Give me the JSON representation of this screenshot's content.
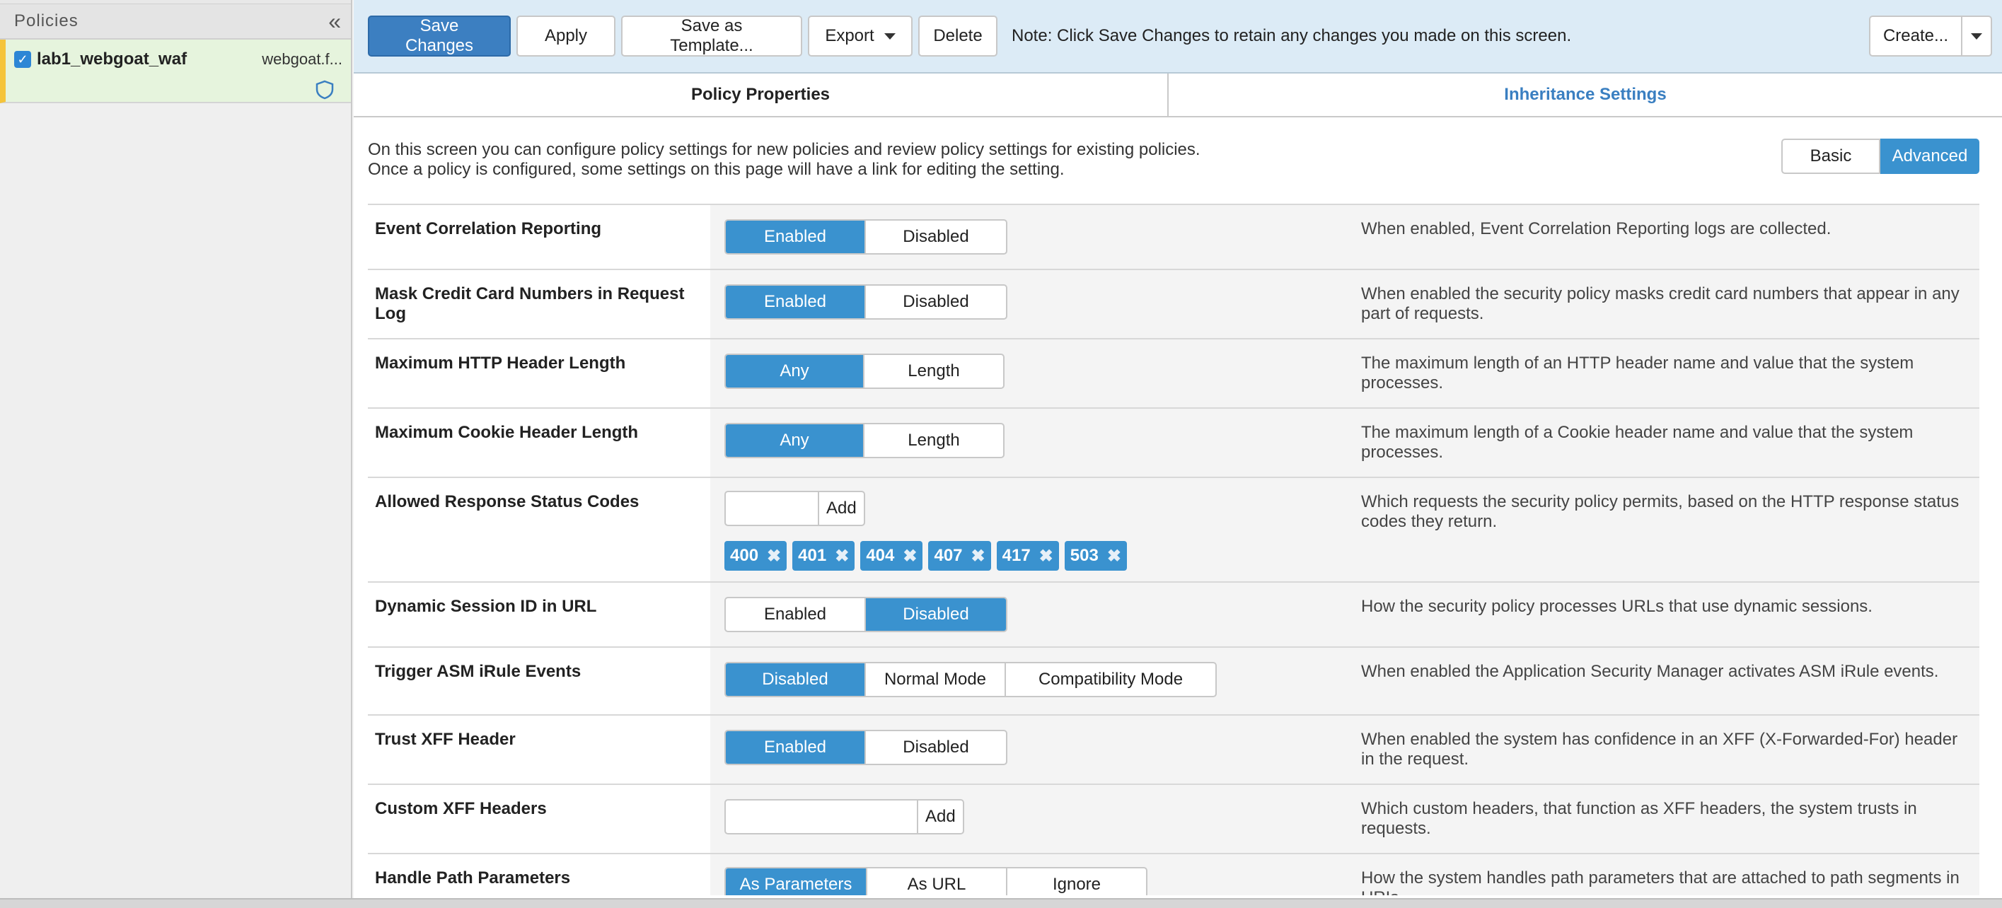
{
  "sidebar": {
    "title": "Policies",
    "collapse_icon": "«",
    "policy": {
      "name": "lab1_webgoat_waf",
      "host": "webgoat.f...",
      "checked": true
    }
  },
  "toolbar": {
    "save_label": "Save Changes",
    "apply_label": "Apply",
    "save_template_label": "Save as Template...",
    "export_label": "Export",
    "delete_label": "Delete",
    "note": "Note: Click Save Changes to retain any changes you made on this screen.",
    "create_label": "Create..."
  },
  "tabs": {
    "active": "Policy Properties",
    "inactive": "Inheritance Settings"
  },
  "intro": {
    "line1": "On this screen you can configure policy settings for new policies and review policy settings for existing policies.",
    "line2": "Once a policy is configured, some settings on this page will have a link for editing the setting.",
    "basic_label": "Basic",
    "advanced_label": "Advanced"
  },
  "settings": [
    {
      "label": "Event Correlation Reporting",
      "options": [
        "Enabled",
        "Disabled"
      ],
      "selected": "Enabled",
      "description": "When enabled, Event Correlation Reporting logs are collected."
    },
    {
      "label": "Mask Credit Card Numbers in Request Log",
      "options": [
        "Enabled",
        "Disabled"
      ],
      "selected": "Enabled",
      "description": "When enabled the security policy masks credit card numbers that appear in any part of requests."
    },
    {
      "label": "Maximum HTTP Header Length",
      "options": [
        "Any",
        "Length"
      ],
      "selected": "Any",
      "description": "The maximum length of an HTTP header name and value that the system processes."
    },
    {
      "label": "Maximum Cookie Header Length",
      "options": [
        "Any",
        "Length"
      ],
      "selected": "Any",
      "description": "The maximum length of a Cookie header name and value that the system processes."
    },
    {
      "label": "Allowed Response Status Codes",
      "add_label": "Add",
      "codes": [
        "400",
        "401",
        "404",
        "407",
        "417",
        "503"
      ],
      "description": "Which requests the security policy permits, based on the HTTP response status codes they return."
    },
    {
      "label": "Dynamic Session ID in URL",
      "options": [
        "Enabled",
        "Disabled"
      ],
      "selected": "Disabled",
      "description": "How the security policy processes URLs that use dynamic sessions."
    },
    {
      "label": "Trigger ASM iRule Events",
      "options": [
        "Disabled",
        "Normal Mode",
        "Compatibility Mode"
      ],
      "selected": "Disabled",
      "description": "When enabled the Application Security Manager activates ASM iRule events."
    },
    {
      "label": "Trust XFF Header",
      "options": [
        "Enabled",
        "Disabled"
      ],
      "selected": "Enabled",
      "description": "When enabled the system has confidence in an XFF (X-Forwarded-For) header in the request."
    },
    {
      "label": "Custom XFF Headers",
      "add_label": "Add",
      "description": "Which custom headers, that function as XFF headers, the system trusts in requests."
    },
    {
      "label": "Handle Path Parameters",
      "options": [
        "As Parameters",
        "As URL",
        "Ignore"
      ],
      "selected": "As Parameters",
      "description": "How the system handles path parameters that are attached to path segments in URIs."
    }
  ],
  "colors": {
    "primary": "#3c7fc1",
    "selected": "#3a92cf",
    "toolbar_bg": "#dcebf6",
    "policy_bg": "#e6f4dd"
  }
}
